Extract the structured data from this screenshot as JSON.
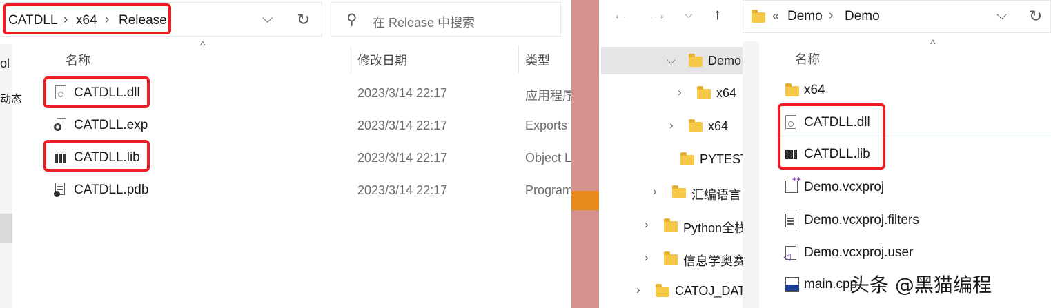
{
  "left": {
    "breadcrumb": [
      "CATDLL",
      "x64",
      "Release"
    ],
    "search_placeholder": "在 Release 中搜索",
    "columns": {
      "name": "名称",
      "date": "修改日期",
      "type": "类型"
    },
    "files": [
      {
        "name": "CATDLL.dll",
        "date": "2023/3/14 22:17",
        "type": "应用程序",
        "icon": "dll-file-icon",
        "highlighted": true
      },
      {
        "name": "CATDLL.exp",
        "date": "2023/3/14 22:17",
        "type": "Exports",
        "icon": "exp-file-icon",
        "highlighted": false
      },
      {
        "name": "CATDLL.lib",
        "date": "2023/3/14 22:17",
        "type": "Object L",
        "icon": "lib-file-icon",
        "highlighted": true
      },
      {
        "name": "CATDLL.pdb",
        "date": "2023/3/14 22:17",
        "type": "Program",
        "icon": "pdb-file-icon",
        "highlighted": false
      }
    ],
    "nav_fragments": [
      "ol",
      "动态"
    ]
  },
  "right": {
    "breadcrumb_prefix": "«",
    "breadcrumb": [
      "Demo",
      "Demo"
    ],
    "tree": [
      {
        "label": "Demo",
        "expanded": true,
        "selected": true
      },
      {
        "label": "x64"
      },
      {
        "label": "x64"
      },
      {
        "label": "PYTEST"
      },
      {
        "label": "汇编语言"
      },
      {
        "label": "Python全栈"
      },
      {
        "label": "信息学奥赛"
      },
      {
        "label": "CATOJ_DAT"
      }
    ],
    "column_name": "名称",
    "files": [
      {
        "name": "x64",
        "icon": "folder-icon",
        "highlighted": false
      },
      {
        "name": "CATDLL.dll",
        "icon": "dll-file-icon",
        "highlighted": true
      },
      {
        "name": "CATDLL.lib",
        "icon": "lib-file-icon",
        "highlighted": true
      },
      {
        "name": "Demo.vcxproj",
        "icon": "vcxproj-file-icon",
        "highlighted": false
      },
      {
        "name": "Demo.vcxproj.filters",
        "icon": "filters-file-icon",
        "highlighted": false
      },
      {
        "name": "Demo.vcxproj.user",
        "icon": "vs-user-file-icon",
        "highlighted": false
      },
      {
        "name": "main.cpp",
        "icon": "cpp-file-icon",
        "highlighted": false
      }
    ]
  },
  "watermark": "头条 @黑猫编程",
  "colors": {
    "highlight_border": "#ee1c24",
    "folder": "#f7c948",
    "divider": "#d4928e",
    "divider_accent": "#e88a1a"
  }
}
